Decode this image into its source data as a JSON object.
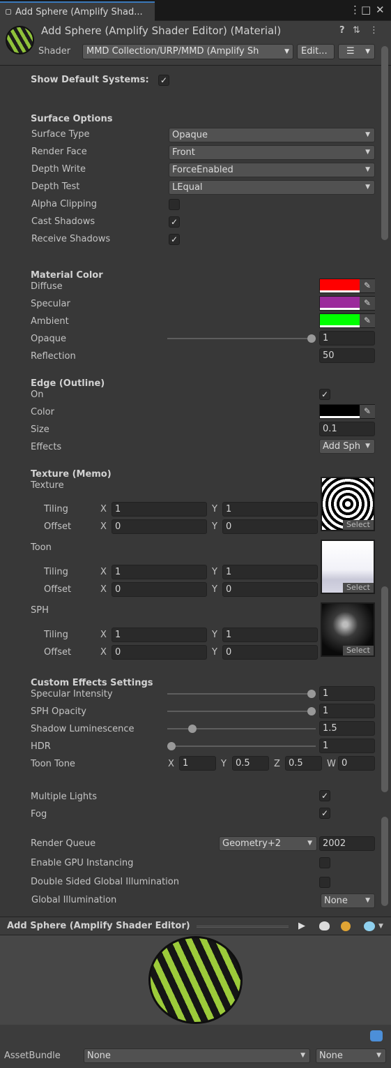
{
  "window": {
    "tab_title": "Add Sphere (Amplify Shad...",
    "menu_glyph": "⋮",
    "maximize_glyph": "□",
    "close_glyph": "✕"
  },
  "header": {
    "title": "Add Sphere (Amplify Shader Editor) (Material)",
    "help_glyph": "?",
    "settings_glyph": "⇅",
    "more_glyph": "⋮",
    "shader_label": "Shader",
    "shader_value": "MMD Collection/URP/MMD (Amplify Sh",
    "edit_label": "Edit...",
    "list_glyph": "☰"
  },
  "show_default": {
    "label": "Show Default Systems:",
    "checked": "✓"
  },
  "surface": {
    "header": "Surface Options",
    "surface_type_label": "Surface Type",
    "surface_type": "Opaque",
    "render_face_label": "Render Face",
    "render_face": "Front",
    "depth_write_label": "Depth Write",
    "depth_write": "ForceEnabled",
    "depth_test_label": "Depth Test",
    "depth_test": "LEqual",
    "alpha_clip_label": "Alpha Clipping",
    "cast_shadows_label": "Cast Shadows",
    "cast_shadows": "✓",
    "receive_shadows_label": "Receive Shadows",
    "receive_shadows": "✓"
  },
  "material_color": {
    "header": "Material Color",
    "diffuse_label": "Diffuse",
    "diffuse_color": "#ff0000",
    "specular_label": "Specular",
    "specular_color": "#9b2a9b",
    "ambient_label": "Ambient",
    "ambient_color": "#00ff00",
    "opaque_label": "Opaque",
    "opaque_value": "1",
    "opaque_fraction": 1.0,
    "reflection_label": "Reflection",
    "reflection_value": "50"
  },
  "edge": {
    "header": "Edge (Outline)",
    "on_label": "On",
    "on_checked": "✓",
    "color_label": "Color",
    "color": "#000000",
    "size_label": "Size",
    "size": "0.1",
    "effects_label": "Effects",
    "effects_value": "Add Sph"
  },
  "texture_memo": {
    "header": "Texture (Memo)",
    "texture_label": "Texture",
    "toon_label": "Toon",
    "sph_label": "SPH",
    "tiling_label": "Tiling",
    "offset_label": "Offset",
    "x_label": "X",
    "y_label": "Y",
    "select_label": "Select",
    "texture_tiling": [
      "1",
      "1"
    ],
    "texture_offset": [
      "0",
      "0"
    ],
    "toon_tiling": [
      "1",
      "1"
    ],
    "toon_offset": [
      "0",
      "0"
    ],
    "sph_tiling": [
      "1",
      "1"
    ],
    "sph_offset": [
      "0",
      "0"
    ]
  },
  "custom_effects": {
    "header": "Custom Effects Settings",
    "spec_intensity_label": "Specular Intensity",
    "spec_intensity": "1",
    "spec_intensity_fraction": 1.0,
    "sph_opacity_label": "SPH Opacity",
    "sph_opacity": "1",
    "sph_opacity_fraction": 1.0,
    "shadow_lum_label": "Shadow Luminescence",
    "shadow_lum": "1.5",
    "shadow_lum_fraction": 0.15,
    "hdr_label": "HDR",
    "hdr": "1",
    "hdr_fraction": 0.0,
    "toon_tone_label": "Toon Tone",
    "toon_tone": {
      "x_label": "X",
      "x": "1",
      "y_label": "Y",
      "y": "0.5",
      "z_label": "Z",
      "z": "0.5",
      "w_label": "W",
      "w": "0"
    }
  },
  "lights": {
    "multiple_lights_label": "Multiple Lights",
    "multiple_lights": "✓",
    "fog_label": "Fog",
    "fog": "✓"
  },
  "advanced": {
    "render_queue_label": "Render Queue",
    "render_queue_dropdown": "Geometry+2",
    "render_queue_value": "2002",
    "gpu_instancing_label": "Enable GPU Instancing",
    "double_sided_gi_label": "Double Sided Global Illumination",
    "global_illumination_label": "Global Illumination",
    "global_illumination": "None"
  },
  "preview": {
    "title": "Add Sphere (Amplify Shader Editor)",
    "play_glyph": "▶"
  },
  "asset_bundle": {
    "label": "AssetBundle",
    "name": "None",
    "variant": "None"
  }
}
